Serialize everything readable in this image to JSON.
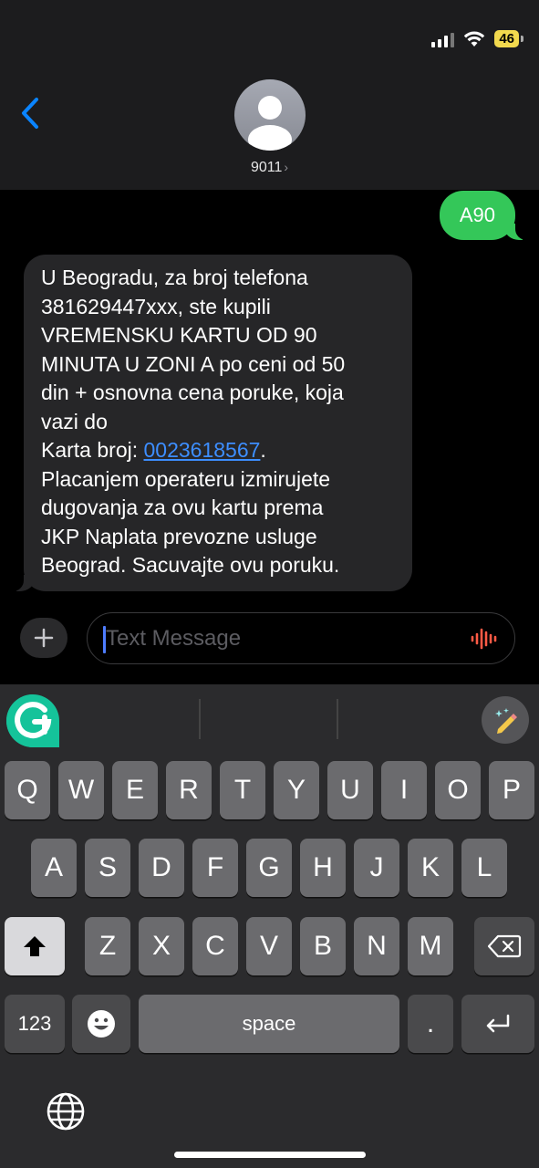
{
  "status_bar": {
    "battery": "46",
    "icons": [
      "cellular-signal-icon",
      "wifi-icon",
      "battery-icon"
    ]
  },
  "header": {
    "back_icon": "chevron-left-icon",
    "avatar_icon": "person-silhouette-icon",
    "contact_name": "9011",
    "contact_chevron": "›"
  },
  "conversation": {
    "outgoing": [
      {
        "text": "A90"
      }
    ],
    "incoming": [
      {
        "text_before_link": "U Beogradu, za broj telefona\n381629447xxx, ste kupili\nVREMENSKU KARTU OD 90\nMINUTA U ZONI A po ceni od 50\ndin + osnovna cena poruke, koja\nvazi do\nKarta broj: ",
        "link": "0023618567",
        "text_after_link": ".\nPlacanjem operateru izmirujete\ndugovanja za ovu kartu prema\nJKP Naplata prevozne usluge\nBeograd. Sacuvajte ovu poruku."
      }
    ]
  },
  "compose": {
    "plus_icon": "plus-icon",
    "placeholder": "Text Message",
    "voice_icon": "waveform-icon"
  },
  "keyboard": {
    "toolbar": {
      "grammarly_icon": "grammarly-logo-icon",
      "magic_icon": "magic-pen-icon"
    },
    "row1": [
      "Q",
      "W",
      "E",
      "R",
      "T",
      "Y",
      "U",
      "I",
      "O",
      "P"
    ],
    "row2": [
      "A",
      "S",
      "D",
      "F",
      "G",
      "H",
      "J",
      "K",
      "L"
    ],
    "row3": [
      "Z",
      "X",
      "C",
      "V",
      "B",
      "N",
      "M"
    ],
    "shift_icon": "shift-icon",
    "delete_icon": "delete-backward-icon",
    "numbers_label": "123",
    "emoji_icon": "emoji-icon",
    "space_label": "space",
    "period_label": ".",
    "return_icon": "return-icon",
    "globe_icon": "globe-icon"
  },
  "colors": {
    "outgoing_bubble": "#34c759",
    "incoming_bubble": "#262628",
    "link": "#3d8eff",
    "accent": "#0a84ff"
  }
}
